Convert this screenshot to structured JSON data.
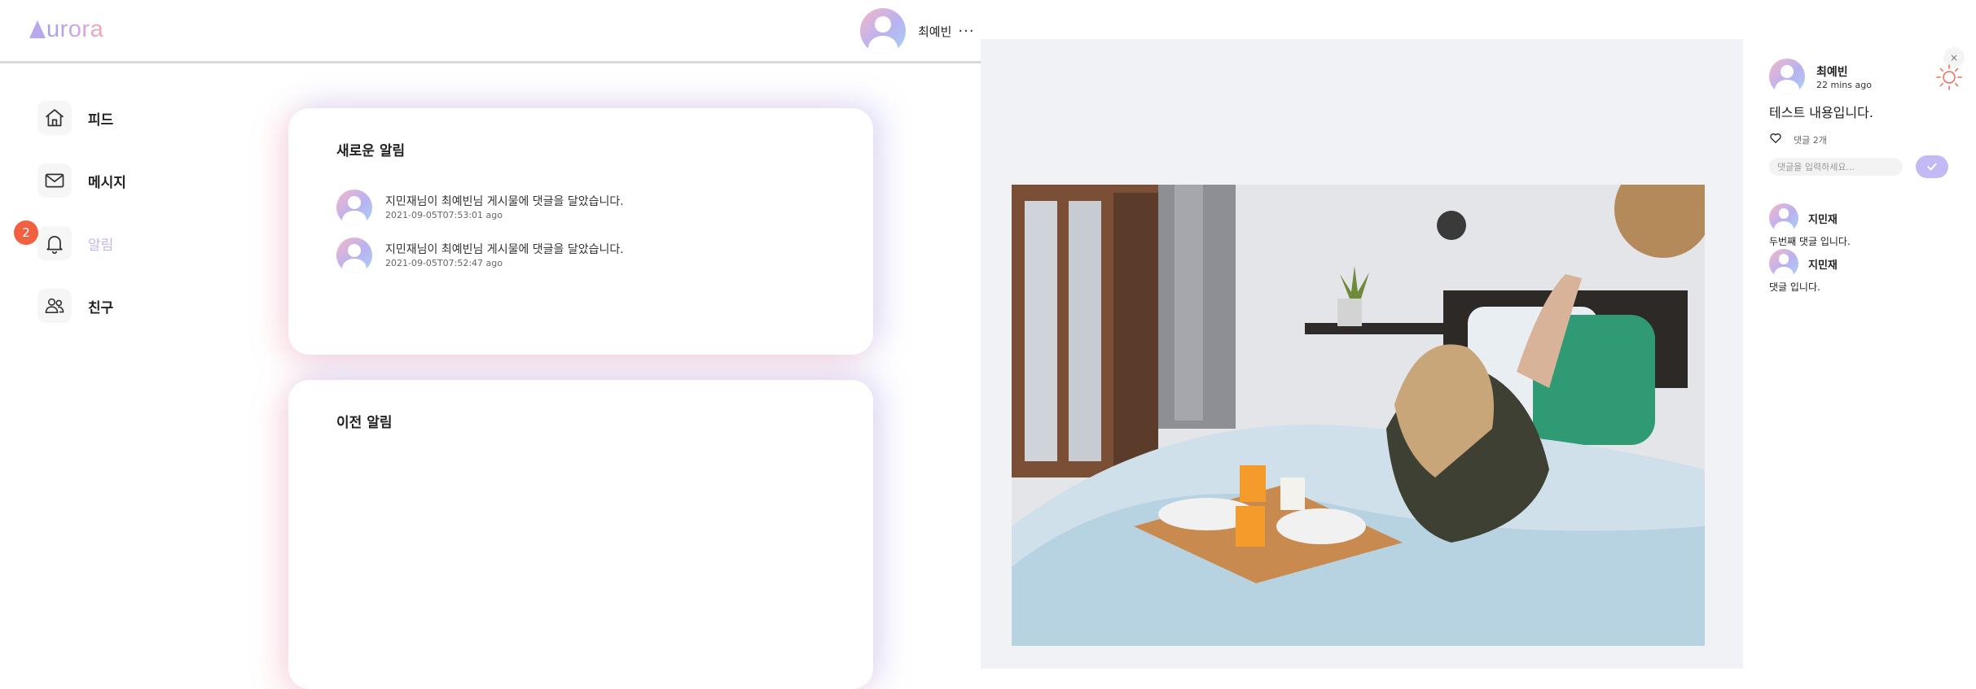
{
  "header": {
    "logo": {
      "first": "",
      "rest": "urora"
    },
    "user_name": "최예빈",
    "more": "···"
  },
  "sidebar": {
    "items": [
      {
        "label": "피드",
        "icon": "home-icon"
      },
      {
        "label": "메시지",
        "icon": "mail-icon"
      },
      {
        "label": "알림",
        "icon": "bell-icon",
        "badge": "2",
        "active": true
      },
      {
        "label": "친구",
        "icon": "friends-icon"
      }
    ]
  },
  "notifications": {
    "new": {
      "title": "새로운 알림",
      "items": [
        {
          "message": "지민재님이 최예빈님 게시물에 댓글을 달았습니다.",
          "time": "2021-09-05T07:53:01 ago"
        },
        {
          "message": "지민재님이 최예빈님 게시물에 댓글을 달았습니다.",
          "time": "2021-09-05T07:52:47 ago"
        }
      ]
    },
    "previous": {
      "title": "이전 알림"
    }
  },
  "post": {
    "close": "×",
    "author": "최예빈",
    "time": "22 mins ago",
    "content": "테스트 내용입니다.",
    "comment_count": "댓글 2개",
    "comment_placeholder": "댓글을 입력하세요...",
    "comments": [
      {
        "author": "지민재",
        "text": "두번째 댓글 입니다."
      },
      {
        "author": "지민재",
        "text": "댓글 입니다."
      }
    ]
  },
  "colors": {
    "accent": "#c3b9f4",
    "badge": "#f2603f",
    "active_nav": "#c7b3f0",
    "sun": "#f06a55"
  }
}
